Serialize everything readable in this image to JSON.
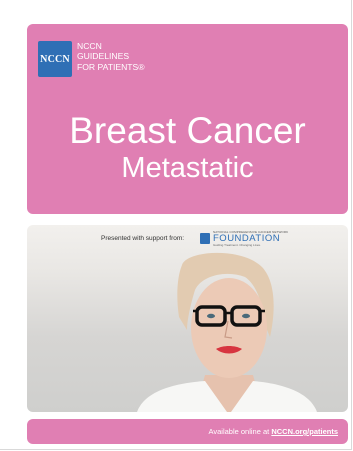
{
  "logo": {
    "mark": "NCCN",
    "lines": [
      "NCCN",
      "GUIDELINES",
      "FOR PATIENTS®"
    ]
  },
  "cover": {
    "title": "Breast Cancer",
    "subtitle": "Metastatic"
  },
  "support": {
    "label": "Presented with support from:",
    "org_small": "NATIONAL COMPREHENSIVE CANCER NETWORK",
    "org_name": "FOUNDATION",
    "org_tagline": "Guiding Treatment. Changing Lives."
  },
  "footer": {
    "prefix": "Available online at ",
    "link": "NCCN.org/patients"
  },
  "colors": {
    "pink": "#e07fb3",
    "blue": "#2f6fb5"
  }
}
